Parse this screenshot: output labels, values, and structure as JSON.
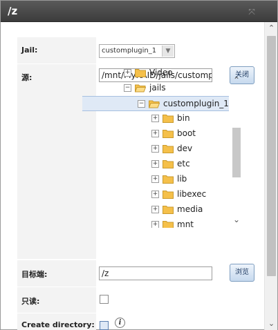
{
  "dialog": {
    "title": "/z",
    "close_glyph": "⤧"
  },
  "form": {
    "jail": {
      "label": "Jail:",
      "value": "customplugin_1"
    },
    "source": {
      "label": "源:",
      "path_value": "/mnt/MyRAID/jails/customplu",
      "close_button": "关闭",
      "tree": [
        {
          "label": "Video",
          "expander": "+",
          "open": false,
          "selected": false,
          "level": 0
        },
        {
          "label": "jails",
          "expander": "−",
          "open": true,
          "selected": false,
          "level": 0
        },
        {
          "label": "customplugin_1",
          "expander": "−",
          "open": true,
          "selected": true,
          "level": 1
        },
        {
          "label": "bin",
          "expander": "+",
          "open": false,
          "selected": false,
          "level": 2
        },
        {
          "label": "boot",
          "expander": "+",
          "open": false,
          "selected": false,
          "level": 2
        },
        {
          "label": "dev",
          "expander": "+",
          "open": false,
          "selected": false,
          "level": 2
        },
        {
          "label": "etc",
          "expander": "+",
          "open": false,
          "selected": false,
          "level": 2
        },
        {
          "label": "lib",
          "expander": "+",
          "open": false,
          "selected": false,
          "level": 2
        },
        {
          "label": "libexec",
          "expander": "+",
          "open": false,
          "selected": false,
          "level": 2
        },
        {
          "label": "media",
          "expander": "+",
          "open": false,
          "selected": false,
          "level": 2
        },
        {
          "label": "mnt",
          "expander": "+",
          "open": false,
          "selected": false,
          "level": 2
        }
      ]
    },
    "destination": {
      "label": "目标端:",
      "value": "/z",
      "browse_button": "浏览"
    },
    "readonly": {
      "label": "只读:",
      "checked": false
    },
    "create_directory": {
      "label": "Create directory:",
      "checked": true,
      "info_glyph": "i"
    }
  },
  "colors": {
    "folder": "#f5c04a",
    "folder_stroke": "#c99a2e",
    "selected_bg": "#dfe9f6"
  }
}
